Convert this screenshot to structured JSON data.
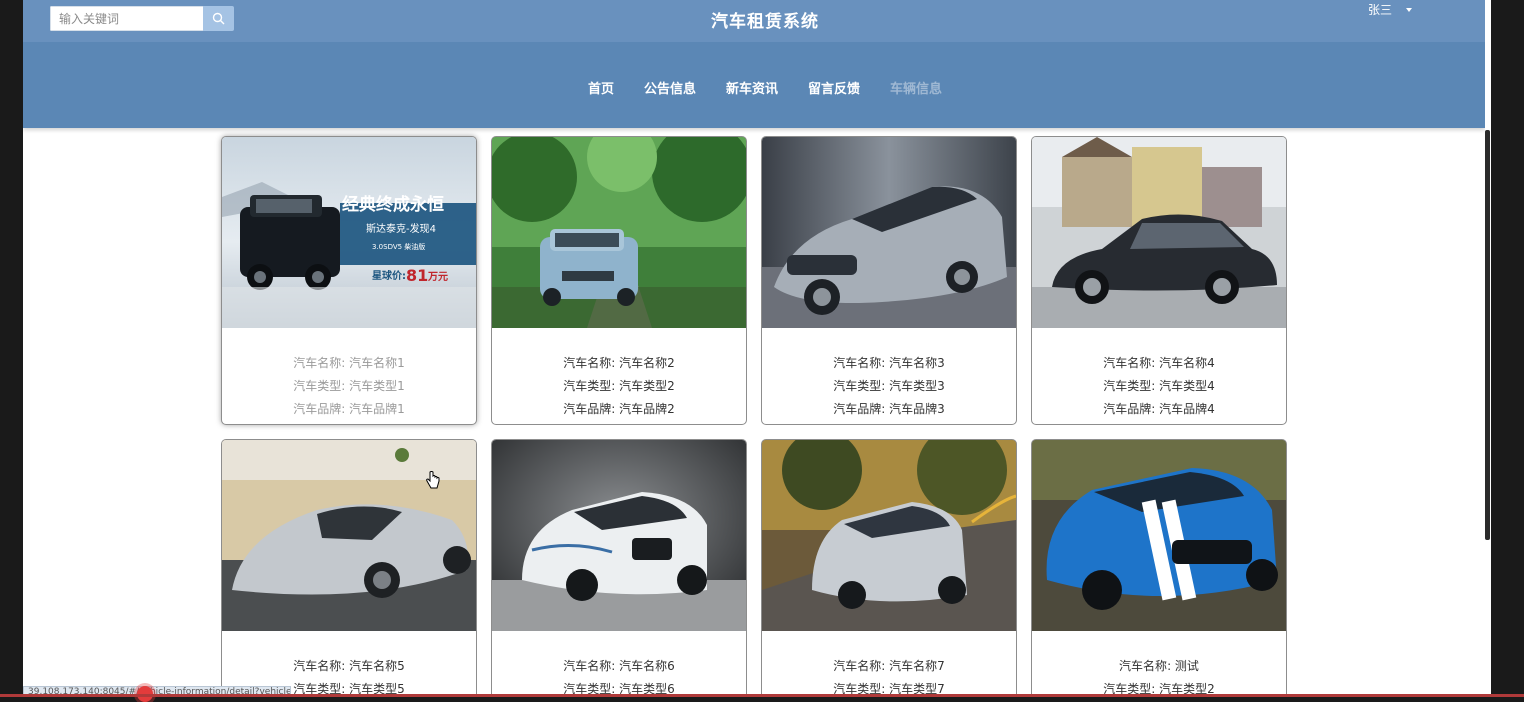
{
  "header": {
    "search_placeholder": "输入关键词",
    "site_title": "汽车租赁系统",
    "user_name": "张三",
    "nav": [
      {
        "label": "首页",
        "active": false
      },
      {
        "label": "公告信息",
        "active": false
      },
      {
        "label": "新车资讯",
        "active": false
      },
      {
        "label": "留言反馈",
        "active": false
      },
      {
        "label": "车辆信息",
        "active": true
      }
    ]
  },
  "field_labels": {
    "name": "汽车名称",
    "type": "汽车类型",
    "brand": "汽车品牌"
  },
  "vehicles": [
    {
      "name": "汽车名称1",
      "type": "汽车类型1",
      "brand": "汽车品牌1",
      "image": "black suv classic ad",
      "banner": {
        "title": "经典终成永恒",
        "model": "斯达泰克-发现4",
        "spec": "3.0SDV5 柴油版",
        "price_label": "星球价:",
        "price": "81",
        "unit": "万元"
      }
    },
    {
      "name": "汽车名称2",
      "type": "汽车类型2",
      "brand": "汽车品牌2",
      "image": "light blue suv forest road"
    },
    {
      "name": "汽车名称3",
      "type": "汽车类型3",
      "brand": "汽车品牌3",
      "image": "silver sedan concept"
    },
    {
      "name": "汽车名称4",
      "type": "汽车类型4",
      "brand": "汽车品牌4",
      "image": "dark sedan parking"
    },
    {
      "name": "汽车名称5",
      "type": "汽车类型5",
      "brand": "",
      "image": "silver sports car desert"
    },
    {
      "name": "汽车名称6",
      "type": "汽车类型6",
      "brand": "",
      "image": "white suv studio"
    },
    {
      "name": "汽车名称7",
      "type": "汽车类型7",
      "brand": "",
      "image": "silver suv road"
    },
    {
      "name": "测试",
      "type": "汽车类型2",
      "brand": "",
      "image": "blue muscle car stripes"
    }
  ],
  "status_url": "39.108.173.140:8045/#/vehicle-information/detail?vehicle_information_id=1",
  "colors": {
    "header": "#5b87b5",
    "topbar": "#6991be",
    "search_button": "#a5c3e4",
    "active_nav": "#9fb8d3"
  }
}
